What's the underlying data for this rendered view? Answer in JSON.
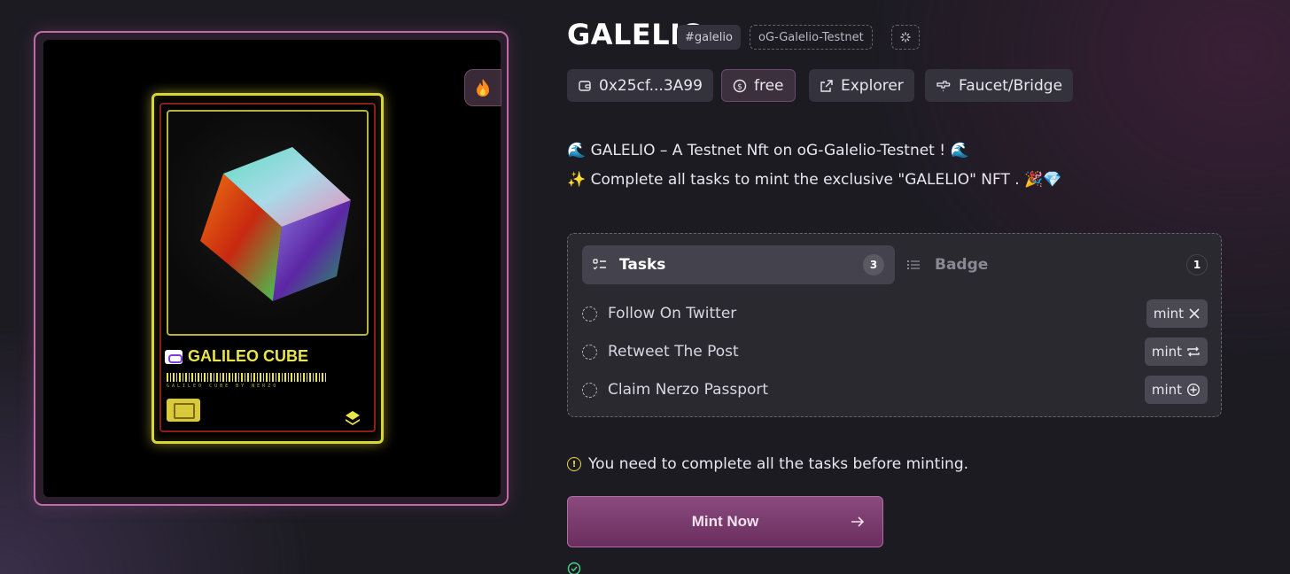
{
  "nft": {
    "card_title": "GALILEO CUBE",
    "barcode_text": "GALILEO CUBE BY NERZO",
    "side_tab_icon": "fire-icon"
  },
  "header": {
    "title": "GALELIO",
    "hashtag": "#galelio",
    "chain": "oG-Galelio-Testnet",
    "loading_icon": "spinner-icon"
  },
  "actions": {
    "address": "0x25cf...3A99",
    "price": "free",
    "explorer": "Explorer",
    "faucet": "Faucet/Bridge"
  },
  "description": {
    "line1": "🌊 GALELIO – A Testnet Nft on oG-Galelio-Testnet ! 🌊",
    "line2": "✨ Complete all tasks to mint the exclusive \"GALELIO\" NFT . 🎉💎"
  },
  "tabs": {
    "tasks_label": "Tasks",
    "tasks_count": "3",
    "badge_label": "Badge",
    "badge_count": "1"
  },
  "tasks": [
    {
      "label": "Follow On Twitter",
      "button": "mint",
      "icon": "x-logo-icon"
    },
    {
      "label": "Retweet The Post",
      "button": "mint",
      "icon": "retweet-icon"
    },
    {
      "label": "Claim Nerzo Passport",
      "button": "mint",
      "icon": "plus-circle-icon"
    }
  ],
  "warning": "You need to complete all the tasks before minting.",
  "mint_button": "Mint Now",
  "colors": {
    "accent": "#8a4a7e",
    "card_yellow": "#d8d43a",
    "warning": "#e8d84a",
    "success": "#4ad88a"
  }
}
